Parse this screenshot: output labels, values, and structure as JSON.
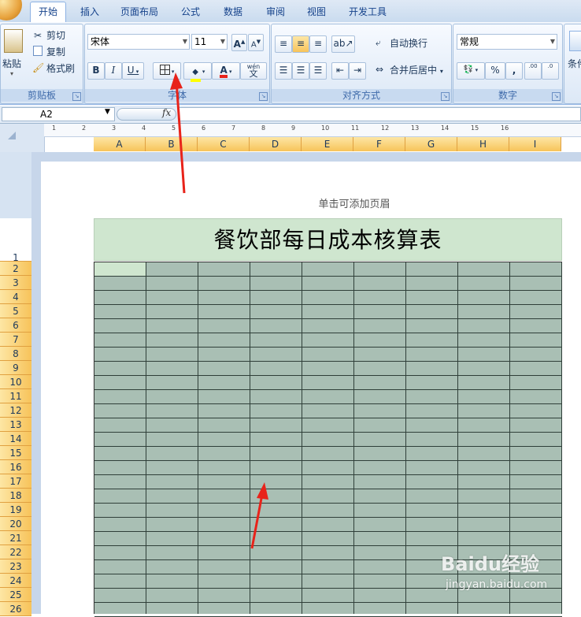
{
  "tabs": [
    "开始",
    "插入",
    "页面布局",
    "公式",
    "数据",
    "审阅",
    "视图",
    "开发工具"
  ],
  "active_tab": "开始",
  "clipboard": {
    "paste": "粘贴",
    "cut": "剪切",
    "copy": "复制",
    "format_painter": "格式刷",
    "label": "剪贴板"
  },
  "font": {
    "name": "宋体",
    "size": "11",
    "bold": "B",
    "italic": "I",
    "underline": "U",
    "label": "字体",
    "color_letter": "A",
    "phonetic": "wén"
  },
  "alignment": {
    "wrap": "自动换行",
    "merge": "合并后居中",
    "label": "对齐方式"
  },
  "number": {
    "format": "常规",
    "percent": "%",
    "comma": ",",
    "inc": ".00",
    "dec": ".0",
    "label": "数字"
  },
  "styles": {
    "conditional": "条件"
  },
  "formula_bar": {
    "cell_ref": "A2",
    "fx": "fx"
  },
  "ruler": [
    "1",
    "2",
    "3",
    "4",
    "5",
    "6",
    "7",
    "8",
    "9",
    "10",
    "11",
    "12",
    "13",
    "14",
    "15",
    "16"
  ],
  "columns": [
    "A",
    "B",
    "C",
    "D",
    "E",
    "F",
    "G",
    "H",
    "I"
  ],
  "rows": [
    "1",
    "2",
    "3",
    "4",
    "5",
    "6",
    "7",
    "8",
    "9",
    "10",
    "11",
    "12",
    "13",
    "14",
    "15",
    "16",
    "17",
    "18",
    "19",
    "20",
    "21",
    "22",
    "23",
    "24",
    "25",
    "26"
  ],
  "header_hint": "单击可添加页眉",
  "sheet_title": "餐饮部每日成本核算表",
  "watermark": {
    "brand": "Baidu经验",
    "url": "jingyan.baidu.com"
  },
  "colors": {
    "title_fill": "#cfe6cf",
    "grid_fill": "#a9bfb4",
    "header_orange": "#f7c35a",
    "arrow": "#e8231a"
  }
}
